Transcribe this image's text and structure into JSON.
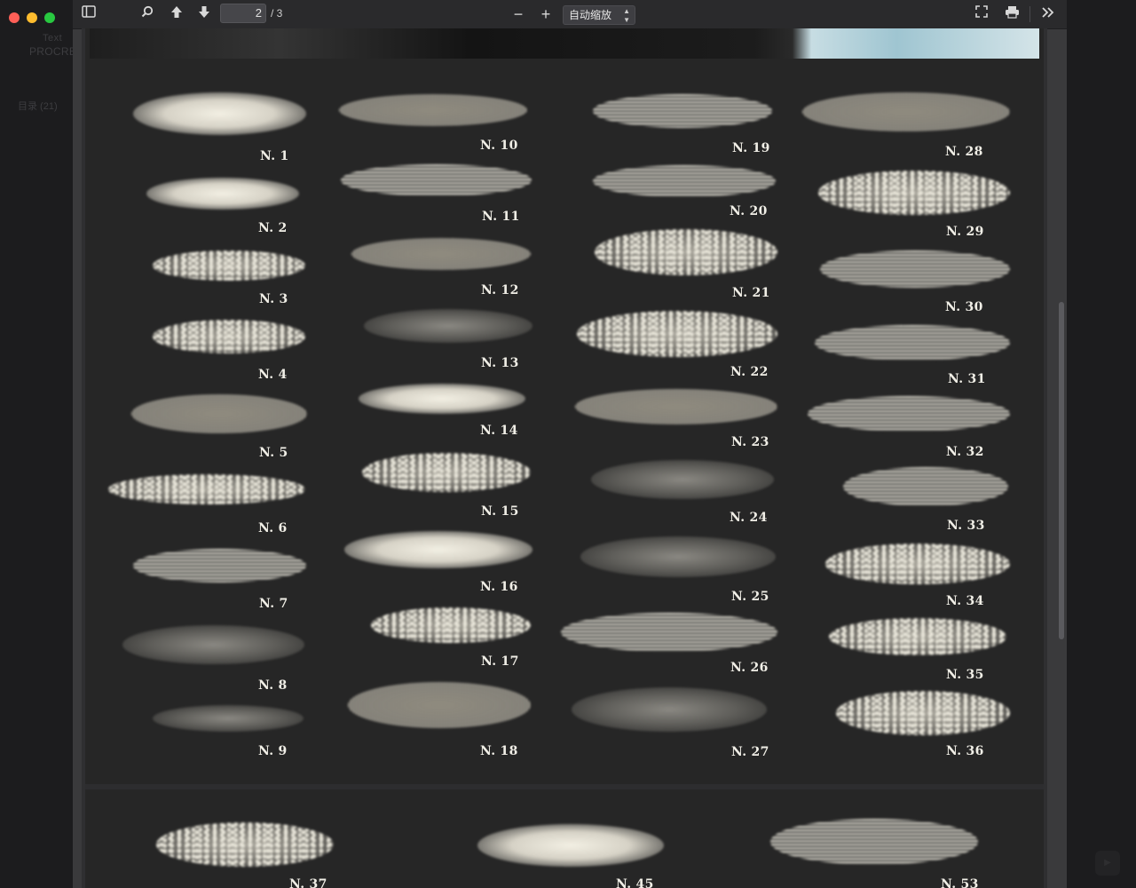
{
  "window": {
    "controls": [
      "close",
      "minimize",
      "zoom"
    ]
  },
  "sidebar": {
    "title_line1": "Text",
    "title_line2": "PROCRE",
    "toc_label": "目录 (21)"
  },
  "toolbar": {
    "sidebar_toggle_icon": "sidebar-toggle-icon",
    "search_icon": "magnifier-icon",
    "prev_page_icon": "arrow-up-icon",
    "next_page_icon": "arrow-down-icon",
    "page_current": "2",
    "page_total": "/ 3",
    "zoom_out_label": "−",
    "zoom_in_label": "+",
    "zoom_value": "自动缩放",
    "fullscreen_icon": "fullscreen-icon",
    "print_icon": "printer-icon",
    "more_icon": "double-chevron-right-icon"
  },
  "brushes": [
    {
      "label": "N. 1"
    },
    {
      "label": "N. 2"
    },
    {
      "label": "N. 3"
    },
    {
      "label": "N. 4"
    },
    {
      "label": "N. 5"
    },
    {
      "label": "N. 6"
    },
    {
      "label": "N. 7"
    },
    {
      "label": "N. 8"
    },
    {
      "label": "N. 9"
    },
    {
      "label": "N. 10"
    },
    {
      "label": "N. 11"
    },
    {
      "label": "N. 12"
    },
    {
      "label": "N. 13"
    },
    {
      "label": "N. 14"
    },
    {
      "label": "N. 15"
    },
    {
      "label": "N. 16"
    },
    {
      "label": "N. 17"
    },
    {
      "label": "N. 18"
    },
    {
      "label": "N. 19"
    },
    {
      "label": "N. 20"
    },
    {
      "label": "N. 21"
    },
    {
      "label": "N. 22"
    },
    {
      "label": "N. 23"
    },
    {
      "label": "N. 24"
    },
    {
      "label": "N. 25"
    },
    {
      "label": "N. 26"
    },
    {
      "label": "N. 27"
    },
    {
      "label": "N. 28"
    },
    {
      "label": "N. 29"
    },
    {
      "label": "N. 30"
    },
    {
      "label": "N. 31"
    },
    {
      "label": "N. 32"
    },
    {
      "label": "N. 33"
    },
    {
      "label": "N. 34"
    },
    {
      "label": "N. 35"
    },
    {
      "label": "N. 36"
    },
    {
      "label": "N. 37"
    },
    {
      "label": "N. 45"
    },
    {
      "label": "N. 53"
    }
  ]
}
